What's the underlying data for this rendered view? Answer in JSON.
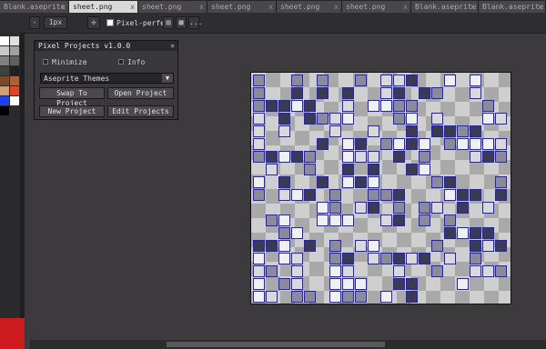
{
  "tabs": [
    {
      "label": "Blank.aseprite",
      "active": false
    },
    {
      "label": "sheet.png",
      "active": true
    },
    {
      "label": "sheet.png",
      "active": false
    },
    {
      "label": "sheet.png",
      "active": false
    },
    {
      "label": "sheet.png",
      "active": false
    },
    {
      "label": "sheet.png",
      "active": false
    },
    {
      "label": "Blank.aseprite",
      "active": false
    },
    {
      "label": "Blank.aseprite",
      "active": false
    }
  ],
  "tab_close_glyph": "x",
  "toolbar": {
    "brush_size": "1px",
    "pixel_perfect_label": "Pixel-perfect",
    "pixel_perfect_checked": true,
    "more_glyph": "...",
    "minus_glyph": "-"
  },
  "dialog": {
    "title": "Pixel Projects v1.0.0",
    "close_glyph": "×",
    "minimize_label": "Minimize",
    "info_label": "Info",
    "selected_project": "Aseprite Themes",
    "swap_button": "Swap To Project",
    "open_button": "Open Project",
    "new_button": "New Project",
    "edit_button": "Edit Projects"
  },
  "colors": {
    "accent_blue": "#1f1fd6",
    "selected_color": "#cc1a1e",
    "palette": [
      "#ffffff",
      "#e0e0e0",
      "#c8c8c8",
      "#a0a0a0",
      "#808080",
      "#606060",
      "#404040",
      "#202020",
      "#7a4a2a",
      "#b06030",
      "#d0a070",
      "#f04020",
      "#2040f0",
      "#ffffff",
      "#000000"
    ]
  }
}
